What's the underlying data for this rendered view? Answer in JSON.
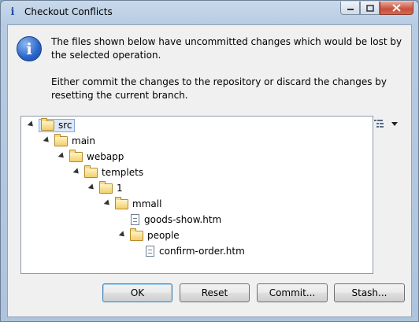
{
  "window": {
    "title": "Checkout Conflicts",
    "title_icon": "i"
  },
  "message": {
    "line1": "The files shown below have uncommitted changes which would be lost by the selected operation.",
    "line2": "Either commit the changes to the repository or discard the changes by resetting the current branch."
  },
  "tree": {
    "items": [
      {
        "label": "src",
        "type": "folder",
        "depth": 0
      },
      {
        "label": "main",
        "type": "folder",
        "depth": 1
      },
      {
        "label": "webapp",
        "type": "folder",
        "depth": 2
      },
      {
        "label": "templets",
        "type": "folder",
        "depth": 3
      },
      {
        "label": "1",
        "type": "folder",
        "depth": 4
      },
      {
        "label": "mmall",
        "type": "folder",
        "depth": 5
      },
      {
        "label": "goods-show.htm",
        "type": "file",
        "depth": 6
      },
      {
        "label": "people",
        "type": "folder",
        "depth": 6
      },
      {
        "label": "confirm-order.htm",
        "type": "file",
        "depth": 7
      }
    ]
  },
  "buttons": {
    "ok": "OK",
    "reset": "Reset",
    "commit": "Commit...",
    "stash": "Stash..."
  }
}
